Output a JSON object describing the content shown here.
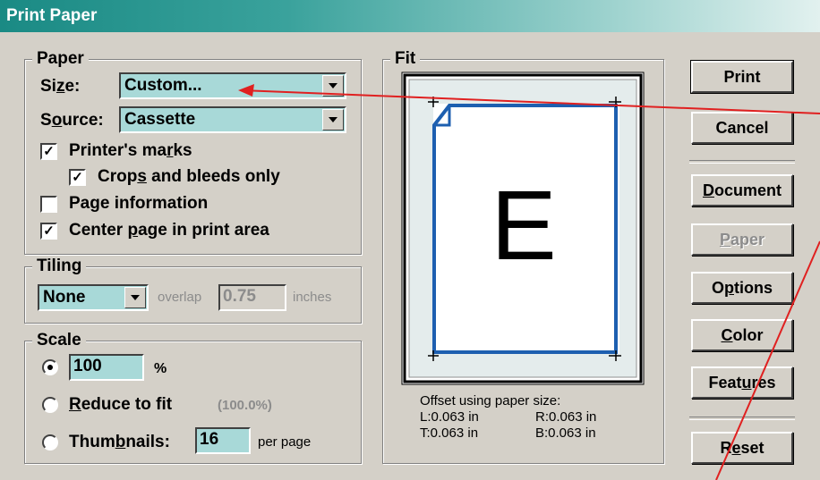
{
  "window": {
    "title": "Print Paper"
  },
  "paper": {
    "legend": "Paper",
    "size_label": "Size:",
    "size_value": "Custom...",
    "source_label": "Source:",
    "source_value": "Cassette",
    "printers_marks": {
      "label": "Printer's marks",
      "checked": true
    },
    "crops_bleeds": {
      "label": "Crops and bleeds only",
      "checked": true
    },
    "page_info": {
      "label": "Page information",
      "checked": false
    },
    "center_page": {
      "label": "Center page in print area",
      "checked": true
    }
  },
  "tiling": {
    "legend": "Tiling",
    "mode_value": "None",
    "overlap_label": "overlap",
    "overlap_value": "0.75",
    "units": "inches"
  },
  "scale": {
    "legend": "Scale",
    "percent_value": "100",
    "percent_sign": "%",
    "reduce_label": "Reduce to fit",
    "reduce_value": "(100.0%)",
    "thumbnails_label": "Thumbnails:",
    "thumbnails_value": "16",
    "per_page": "per page",
    "selected": "percent"
  },
  "fit": {
    "legend": "Fit",
    "preview_letter": "E",
    "offset_title": "Offset using paper size:",
    "left": "L:0.063 in",
    "right": "R:0.063 in",
    "top": "T:0.063 in",
    "bottom": "B:0.063 in"
  },
  "buttons": {
    "print": "Print",
    "cancel": "Cancel",
    "document": "Document",
    "paper": "Paper",
    "options": "Options",
    "color": "Color",
    "features": "Features",
    "reset": "Reset"
  },
  "colors": {
    "title_gradient_start": "#1a8a84",
    "field_bg": "#a8d9d8",
    "page_border": "#1d5fb0",
    "annotation_arrow": "#e02020"
  }
}
